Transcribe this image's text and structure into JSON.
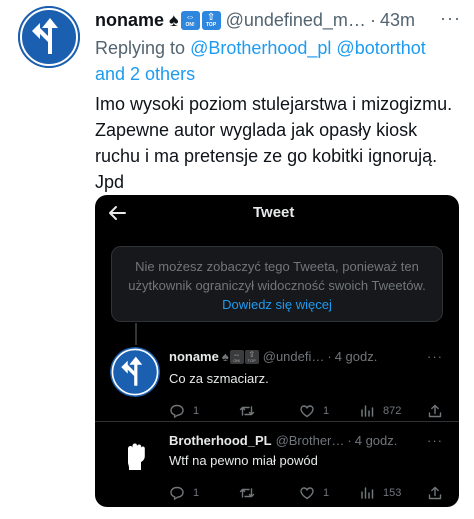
{
  "tweet": {
    "author_name": "noname",
    "badges": [
      {
        "icon": "spade-icon",
        "glyph": "♠"
      },
      {
        "icon": "on-badge-icon",
        "glyph": "⇔",
        "sub": "ON!"
      },
      {
        "icon": "top-badge-icon",
        "glyph": "⇧",
        "sub": "TOP"
      }
    ],
    "handle": "@undefined_m…",
    "separator": "·",
    "time": "43m",
    "more": "···",
    "replying_prefix": "Replying to ",
    "replying_users": "@Brotherhood_pl @botorthot",
    "replying_suffix": "and 2 others",
    "text": "Imo wysoki poziom stulejarstwa i mizogizmu.  Zapewne autor wyglada jak opasły kiosk ruchu i ma pretensje ze go kobitki ignorują. Jpd"
  },
  "embed": {
    "title": "Tweet",
    "back_icon": "back-arrow-icon",
    "notice_text": "Nie możesz zobaczyć tego Tweeta, ponieważ ten użytkownik ograniczył widoczność swoich Tweetów. ",
    "notice_link": "Dowiedz się więcej",
    "replies": [
      {
        "name": "noname",
        "badges": [
          "♠",
          "⇔",
          "⇧"
        ],
        "handle": "@undefi…",
        "separator": "·",
        "time": "4 godz.",
        "more": "···",
        "text": "Co za szmaciarz.",
        "reply_count": "1",
        "retweet_count": "",
        "like_count": "1",
        "views": "872"
      },
      {
        "name": "Brotherhood_PL",
        "handle": "@Brother…",
        "separator": "·",
        "time": "4 godz.",
        "more": "···",
        "text": "Wtf na pewno miał powód",
        "reply_count": "1",
        "retweet_count": "",
        "like_count": "1",
        "views": "153"
      }
    ]
  },
  "colors": {
    "link": "#1d9bf0",
    "muted": "#536471",
    "embed_bg": "#000000",
    "badge_blue": "#2e86de",
    "avatar_blue": "#1b5fb0"
  }
}
